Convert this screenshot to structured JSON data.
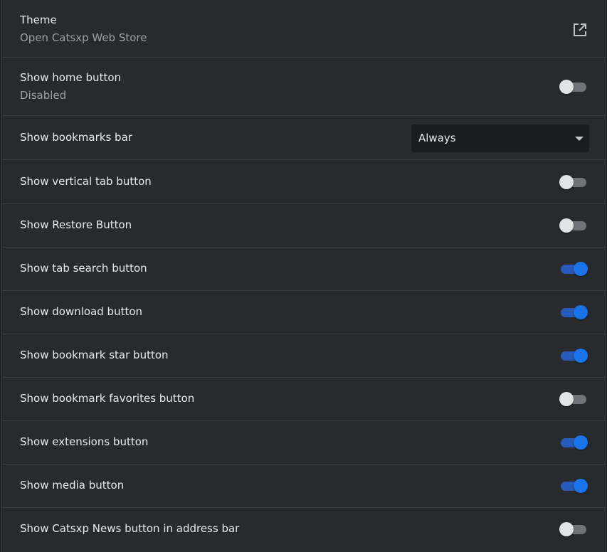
{
  "theme": {
    "title": "Theme",
    "subtitle": "Open Catsxp Web Store",
    "link_icon": "open-in-new-icon"
  },
  "home_button": {
    "label": "Show home button",
    "status": "Disabled",
    "enabled": false
  },
  "bookmarks_bar": {
    "label": "Show bookmarks bar",
    "selected": "Always"
  },
  "toggles": [
    {
      "label": "Show vertical tab button",
      "enabled": false
    },
    {
      "label": "Show Restore Button",
      "enabled": false
    },
    {
      "label": "Show tab search button",
      "enabled": true
    },
    {
      "label": "Show download button",
      "enabled": true
    },
    {
      "label": "Show bookmark star button",
      "enabled": true
    },
    {
      "label": "Show bookmark favorites button",
      "enabled": false
    },
    {
      "label": "Show extensions button",
      "enabled": true
    },
    {
      "label": "Show media button",
      "enabled": true
    },
    {
      "label": "Show Catsxp News button in address bar",
      "enabled": false
    }
  ],
  "colors": {
    "background": "#292a2d",
    "accent": "#1a73e8",
    "text_primary": "#e8eaed",
    "text_secondary": "#9aa0a6"
  }
}
